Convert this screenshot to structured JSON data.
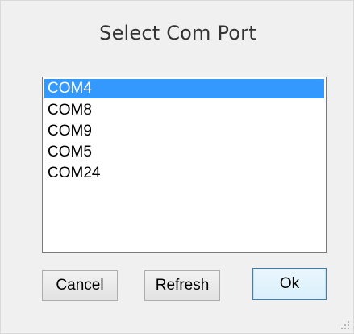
{
  "dialog": {
    "title": "Select Com Port"
  },
  "port_list": {
    "items": [
      "COM4",
      "COM8",
      "COM9",
      "COM5",
      "COM24"
    ],
    "selected": "COM4"
  },
  "buttons": {
    "cancel": "Cancel",
    "refresh": "Refresh",
    "ok": "Ok"
  },
  "icons": {
    "resize_grip": "size-grip-icon"
  },
  "colors": {
    "selection": "#3399ff",
    "dialog_background": "#f0f0f0",
    "default_button_border": "#3c7fb1"
  }
}
